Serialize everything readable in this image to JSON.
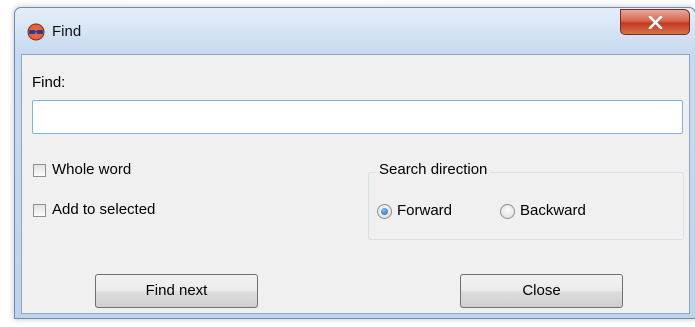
{
  "window": {
    "title": "Find",
    "app_icon": "3d-glasses-icon",
    "close_icon": "close-x-icon",
    "accent_close": "#c23a20"
  },
  "find": {
    "label": "Find:",
    "value": "",
    "placeholder": ""
  },
  "options": {
    "whole_word": {
      "label": "Whole word",
      "checked": false
    },
    "add_to_selected": {
      "label": "Add to selected",
      "checked": false
    }
  },
  "search_direction": {
    "title": "Search direction",
    "forward": {
      "label": "Forward",
      "selected": true
    },
    "backward": {
      "label": "Backward",
      "selected": false
    }
  },
  "buttons": {
    "find_next": "Find next",
    "close": "Close"
  }
}
